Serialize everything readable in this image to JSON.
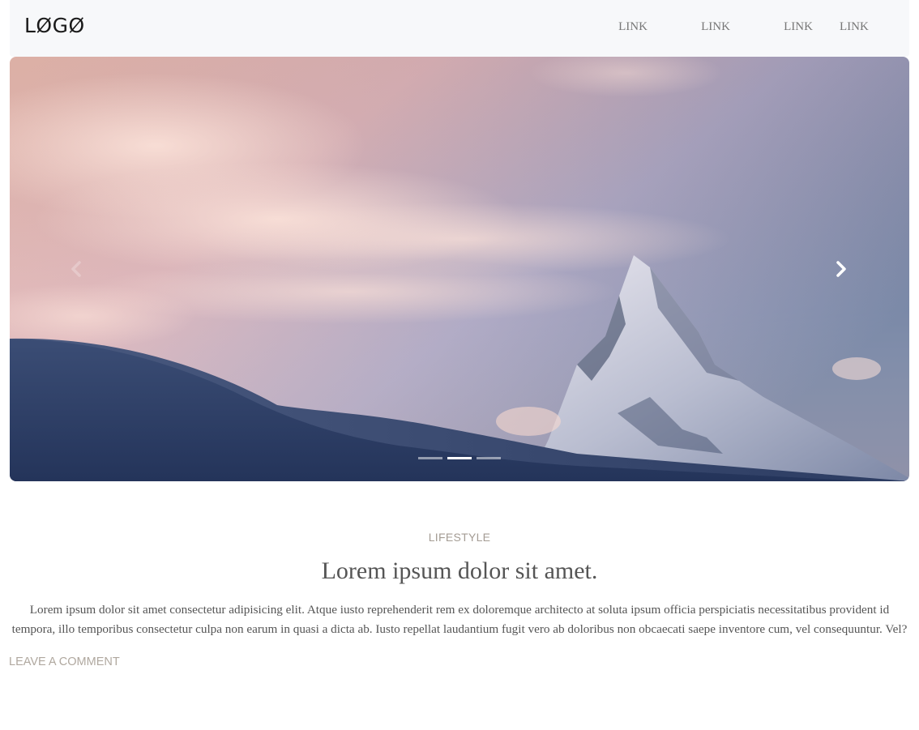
{
  "navbar": {
    "logo": "LØGØ",
    "links": [
      "LINK",
      "LINK",
      "LINK",
      "LINK"
    ]
  },
  "carousel": {
    "prev_icon": "chevron-left-icon",
    "next_icon": "chevron-right-icon",
    "slide_count": 3,
    "active_slide": 2
  },
  "post": {
    "category": "LIFESTYLE",
    "title": "Lorem ipsum dolor sit amet.",
    "body": "Lorem ipsum dolor sit amet consectetur adipisicing elit. Atque iusto reprehenderit rem ex doloremque architecto at soluta ipsum officia perspiciatis necessitatibus provident id tempora, illo temporibus consectetur culpa non earum in quasi a dicta ab. Iusto repellat laudantium fugit vero ab doloribus non obcaecati saepe inventore cum, vel consequuntur. Vel?",
    "comment_link": "LEAVE A COMMENT"
  },
  "colors": {
    "navbar_bg": "#f7f8fa",
    "accent_muted": "#a49c94",
    "text": "#555555"
  }
}
